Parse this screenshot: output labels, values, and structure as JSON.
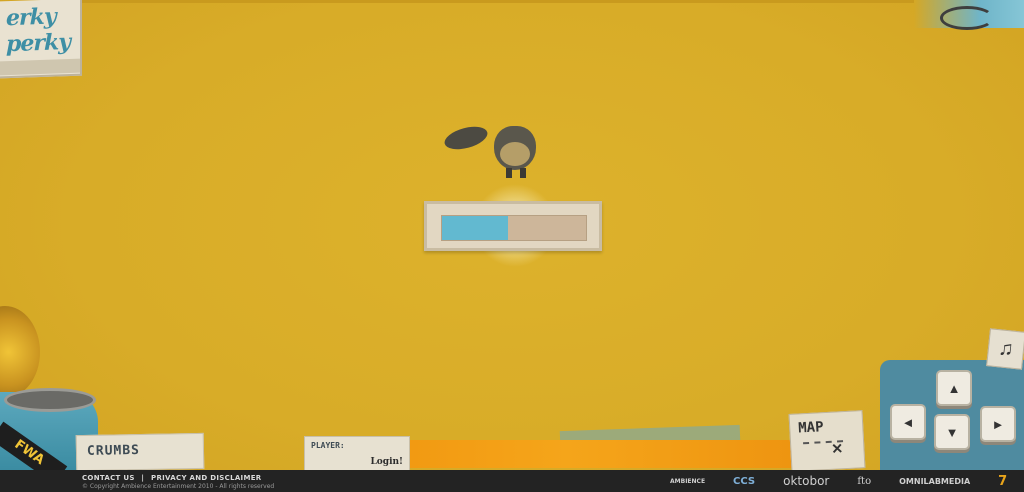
{
  "logo": {
    "line1": "erky",
    "line2": "perky"
  },
  "loader": {
    "progress": 0.46,
    "fill_color": "#62B9D0"
  },
  "bottom": {
    "badge_text": "FWA",
    "crumbs_label": "CRUMBS",
    "player_label": "PLAYER:",
    "login_label": "Login!",
    "map_label": "MAP"
  },
  "keys": {
    "up": "▲",
    "left": "◄",
    "down": "▼",
    "right": "►",
    "music": "♫"
  },
  "footer": {
    "contact": "CONTACT US",
    "separator": "|",
    "privacy": "PRIVACY AND DISCLAIMER",
    "copyright": "© Copyright Ambience Entertainment 2010 - All rights reserved"
  },
  "partners": {
    "ambience": "AMBIENCE",
    "ccs": "CCS",
    "oktobor": "oktobor",
    "fto": "fto",
    "omnilab": "OMNILABMEDIA",
    "seven": "7"
  },
  "colors": {
    "background": "#D9AE2A",
    "accent_blue": "#62B9D0",
    "orange": "#F29A12",
    "footer": "#232323"
  }
}
